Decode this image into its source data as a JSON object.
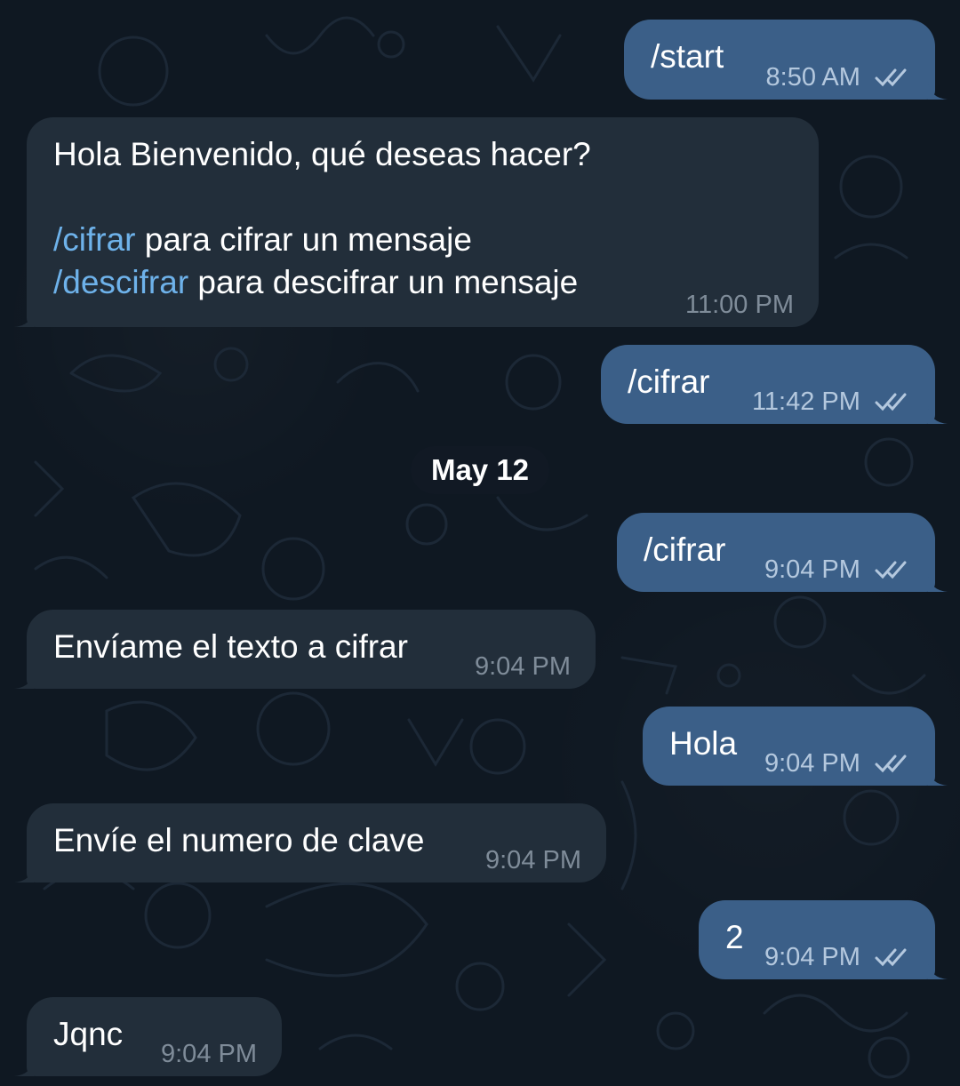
{
  "chat": {
    "date_separator": "May 12",
    "messages": [
      {
        "direction": "out",
        "text": "/start",
        "time": "8:50 AM",
        "status_icon": "double-check-icon"
      },
      {
        "direction": "in",
        "lines": [
          {
            "plain": "Hola Bienvenido, qué deseas hacer?"
          },
          {
            "plain": ""
          },
          {
            "command": "/cifrar",
            "plain": " para cifrar un mensaje"
          },
          {
            "command": "/descifrar",
            "plain": " para descifrar un mensaje"
          }
        ],
        "time": "11:00 PM"
      },
      {
        "direction": "out",
        "text": "/cifrar",
        "time": "11:42 PM",
        "status_icon": "double-check-icon"
      },
      {
        "direction": "out",
        "text": "/cifrar",
        "time": "9:04 PM",
        "status_icon": "double-check-icon"
      },
      {
        "direction": "in",
        "text": "Envíame el texto a cifrar",
        "time": "9:04 PM"
      },
      {
        "direction": "out",
        "text": "Hola",
        "time": "9:04 PM",
        "status_icon": "double-check-icon"
      },
      {
        "direction": "in",
        "text": "Envíe el numero de clave",
        "time": "9:04 PM"
      },
      {
        "direction": "out",
        "text": "2",
        "time": "9:04 PM",
        "status_icon": "double-check-icon"
      },
      {
        "direction": "in",
        "text": "Jqnc",
        "time": "9:04 PM"
      }
    ]
  },
  "colors": {
    "background": "#0f1822",
    "incoming_bubble": "#222e3a",
    "outgoing_bubble": "#3b5f88",
    "command_link": "#6eb2ea",
    "timestamp_in": "#7f8c99",
    "timestamp_out": "#b4c8de"
  }
}
